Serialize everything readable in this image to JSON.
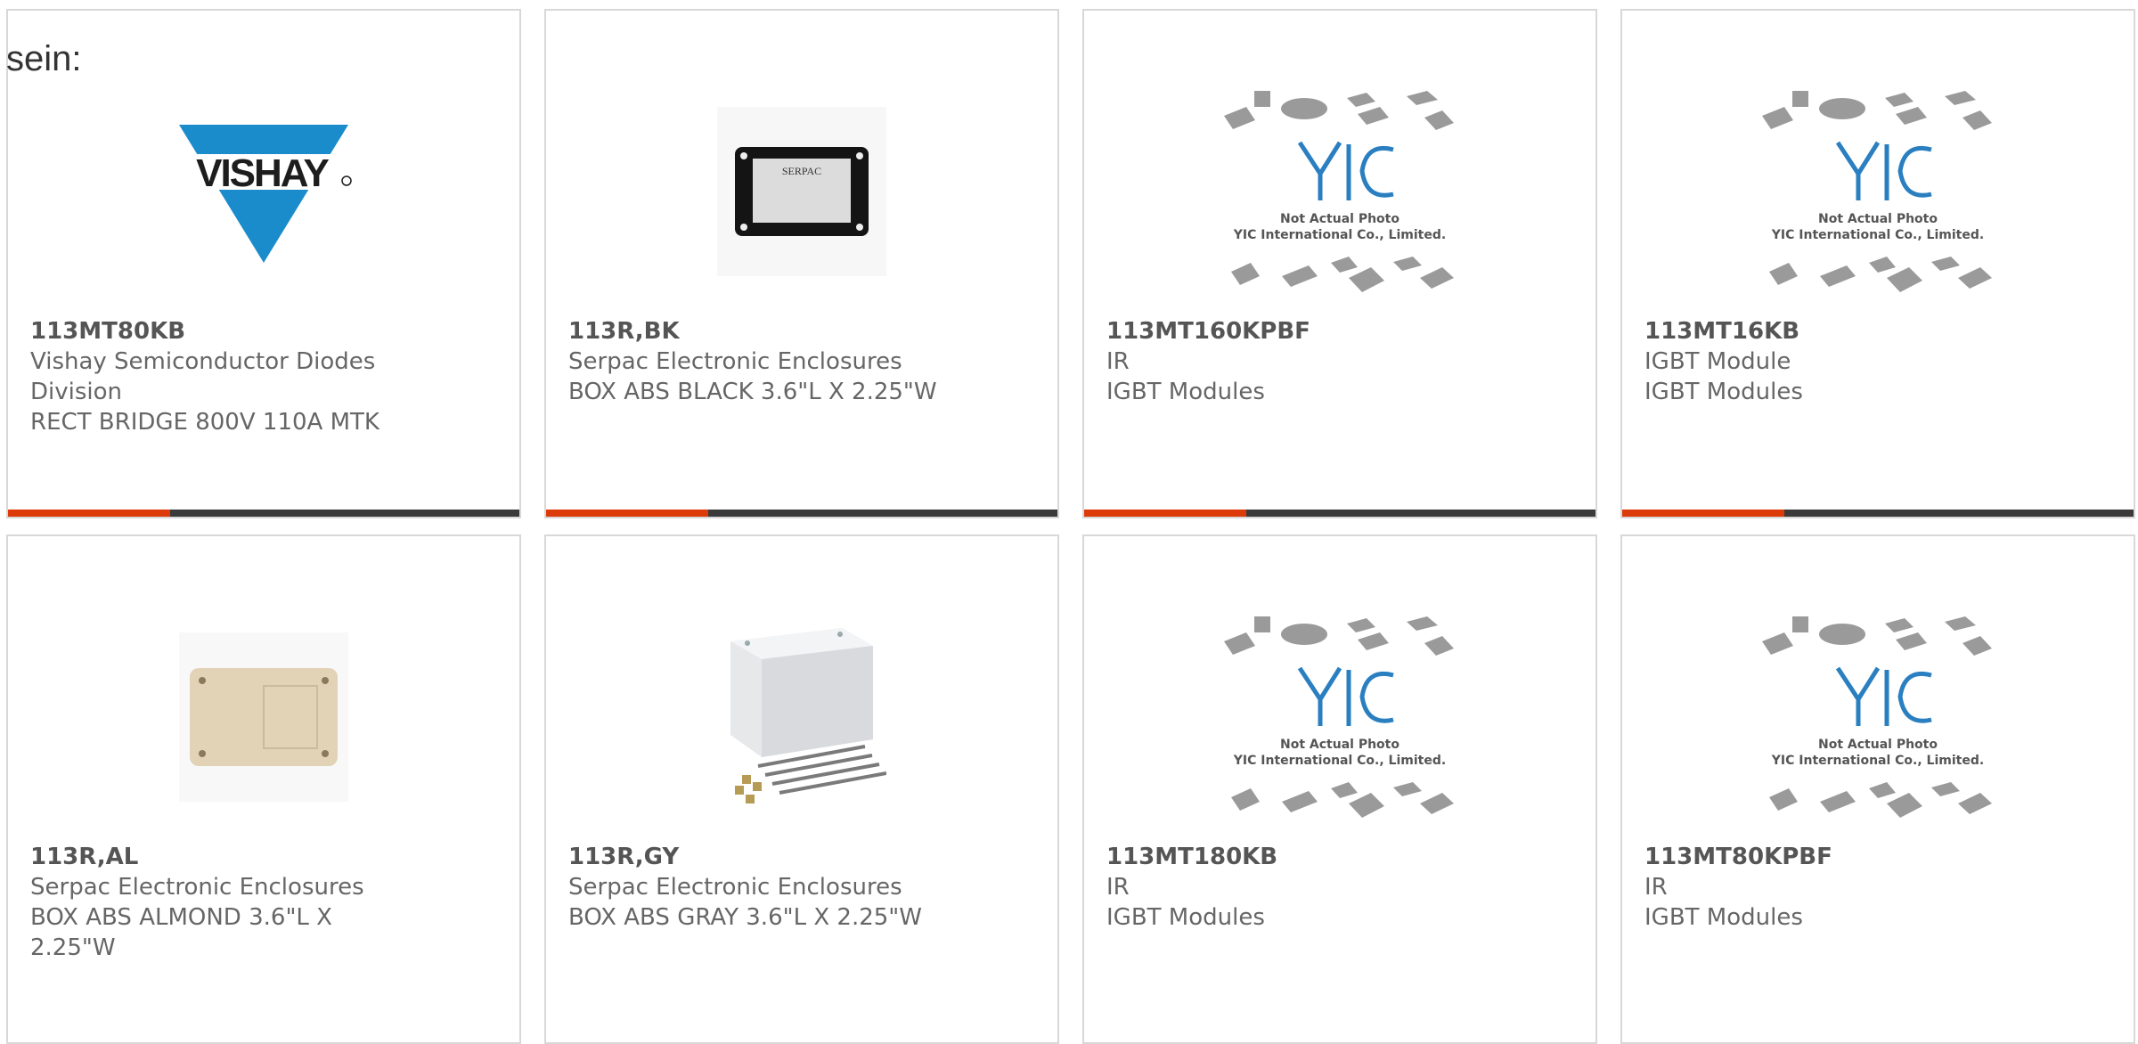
{
  "lead_text": "sein:",
  "placeholder": {
    "caption_1": "Not Actual Photo",
    "caption_2": "YIC International Co., Limited."
  },
  "products": [
    {
      "part_number": "113MT80KB",
      "line1": "Vishay Semiconductor Diodes",
      "line2": "Division",
      "line3": "RECT BRIDGE 800V 110A MTK",
      "image": "vishay-logo"
    },
    {
      "part_number": "113R,BK",
      "line1": "Serpac Electronic Enclosures",
      "line2": "BOX ABS BLACK 3.6\"L X 2.25\"W",
      "line3": "",
      "image": "black-box-enclosure"
    },
    {
      "part_number": "113MT160KPBF",
      "line1": "IR",
      "line2": "IGBT Modules",
      "line3": "",
      "image": "not-actual-photo"
    },
    {
      "part_number": "113MT16KB",
      "line1": "IGBT Module",
      "line2": "IGBT Modules",
      "line3": "",
      "image": "not-actual-photo"
    },
    {
      "part_number": "113R,AL",
      "line1": "Serpac Electronic Enclosures",
      "line2": "BOX ABS ALMOND 3.6\"L X",
      "line3": "2.25\"W",
      "image": "almond-box-enclosure"
    },
    {
      "part_number": "113R,GY",
      "line1": "Serpac Electronic Enclosures",
      "line2": "BOX ABS GRAY 3.6\"L X 2.25\"W",
      "line3": "",
      "image": "gray-box-enclosure"
    },
    {
      "part_number": "113MT180KB",
      "line1": "IR",
      "line2": "IGBT Modules",
      "line3": "",
      "image": "not-actual-photo"
    },
    {
      "part_number": "113MT80KPBF",
      "line1": "IR",
      "line2": "IGBT Modules",
      "line3": "",
      "image": "not-actual-photo"
    }
  ],
  "colors": {
    "accent": "#dd3a0a",
    "bar": "#3a3a3a",
    "border": "#d8d8d8",
    "vishay_blue": "#1a8ccc",
    "yic_blue": "#2a7fc0"
  }
}
